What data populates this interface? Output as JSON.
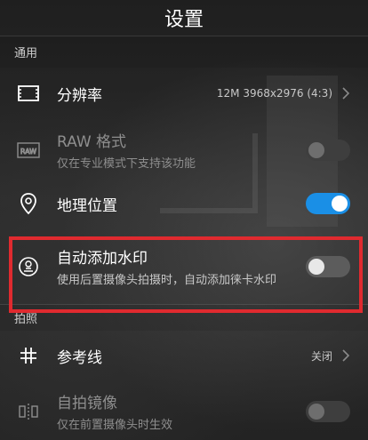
{
  "title": "设置",
  "sections": {
    "general": "通用",
    "photo": "拍照"
  },
  "resolution": {
    "label": "分辨率",
    "value": "12M 3968x2976 (4:3)"
  },
  "raw": {
    "label": "RAW 格式",
    "sub": "仅在专业模式下支持该功能",
    "icon_text": "RAW",
    "enabled": false
  },
  "location": {
    "label": "地理位置",
    "on": true
  },
  "watermark": {
    "label": "自动添加水印",
    "sub": "使用后置摄像头拍摄时，自动添加徕卡水印",
    "on": false
  },
  "gridline": {
    "label": "参考线",
    "value": "关闭"
  },
  "mirror": {
    "label": "自拍镜像",
    "sub": "仅在前置摄像头时生效",
    "enabled": false
  },
  "colors": {
    "toggle_on": "#1a8fe6",
    "highlight": "#e02a2f"
  }
}
